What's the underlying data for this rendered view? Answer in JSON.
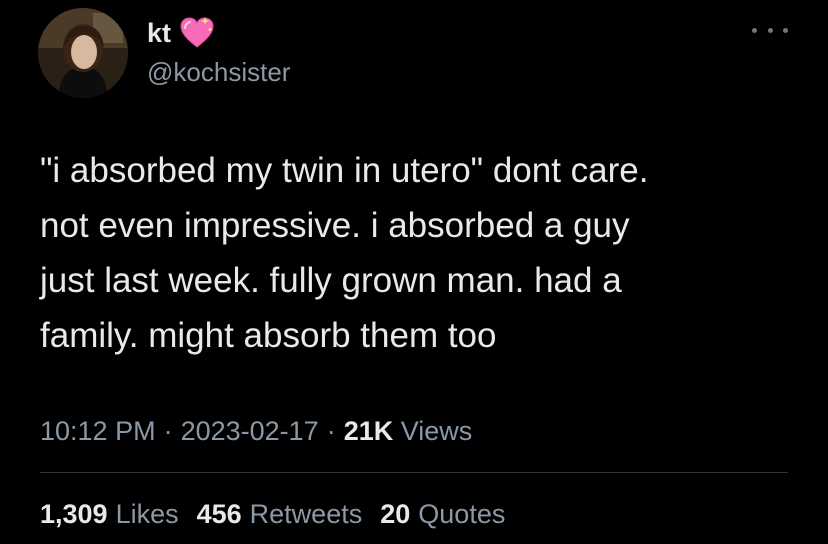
{
  "author": {
    "display_name": "kt",
    "badge_icon": "sparkling-heart-icon",
    "handle": "@kochsister"
  },
  "tweet": {
    "text_lines": [
      "\"i absorbed my twin in utero\" dont care.",
      "not even impressive. i absorbed a guy",
      "just last week. fully grown man. had a",
      "family. might absorb them too"
    ]
  },
  "meta": {
    "time": "10:12 PM",
    "separator": "·",
    "date": "2023-02-17",
    "views_count": "21K",
    "views_label": "Views"
  },
  "stats": {
    "likes_count": "1,309",
    "likes_label": "Likes",
    "retweets_count": "456",
    "retweets_label": "Retweets",
    "quotes_count": "20",
    "quotes_label": "Quotes"
  },
  "colors": {
    "background": "#000000",
    "primary_text": "#e7e9ea",
    "secondary_text": "#8b98a5",
    "divider": "#2f3336",
    "heart_pink": "#f76bb7"
  }
}
